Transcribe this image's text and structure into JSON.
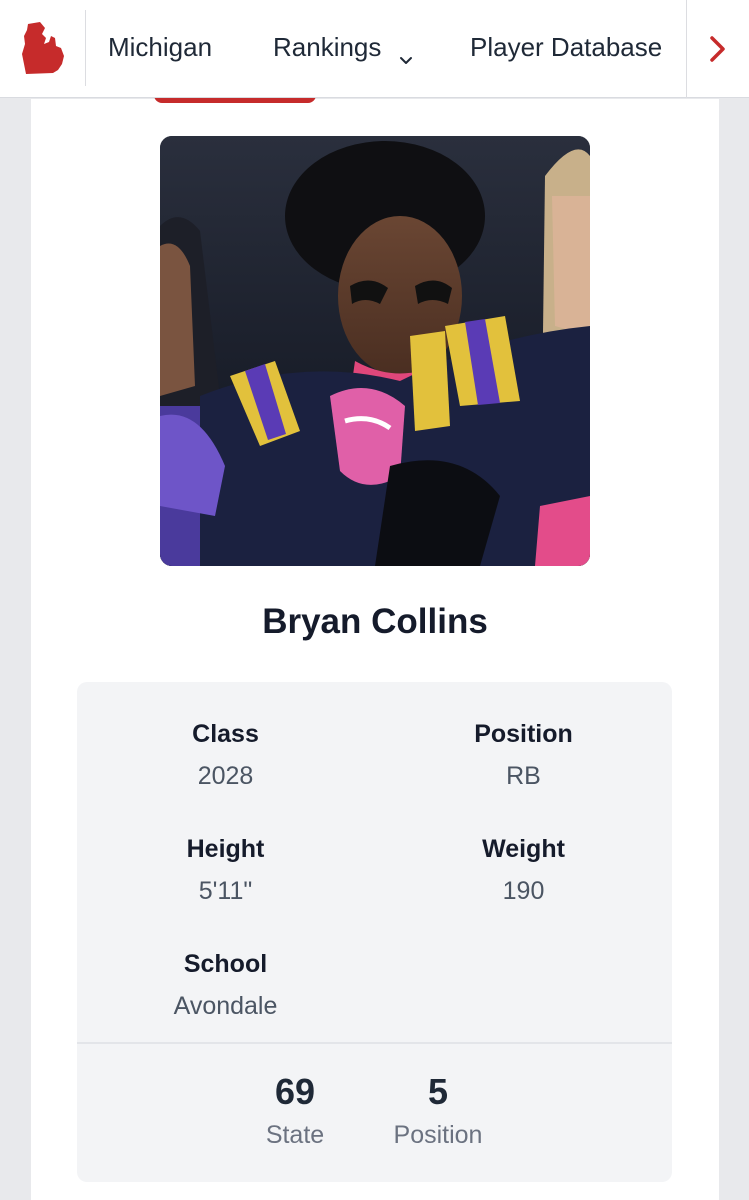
{
  "nav": {
    "logo_icon": "michigan-state-icon",
    "items": [
      {
        "label": "Michigan"
      },
      {
        "label": "Rankings",
        "icon": "chevron-down-icon"
      },
      {
        "label": "Player Database"
      }
    ],
    "next_icon": "chevron-right-icon",
    "accent_color": "#c62b2b"
  },
  "player": {
    "name": "Bryan Collins",
    "photo": "player-photo",
    "fields": {
      "class": {
        "label": "Class",
        "value": "2028"
      },
      "position": {
        "label": "Position",
        "value": "RB"
      },
      "height": {
        "label": "Height",
        "value": "5'11\""
      },
      "weight": {
        "label": "Weight",
        "value": "190"
      },
      "school": {
        "label": "School",
        "value": "Avondale"
      }
    },
    "rankings": {
      "state": {
        "rank": "69",
        "label": "State"
      },
      "position": {
        "rank": "5",
        "label": "Position"
      }
    }
  }
}
